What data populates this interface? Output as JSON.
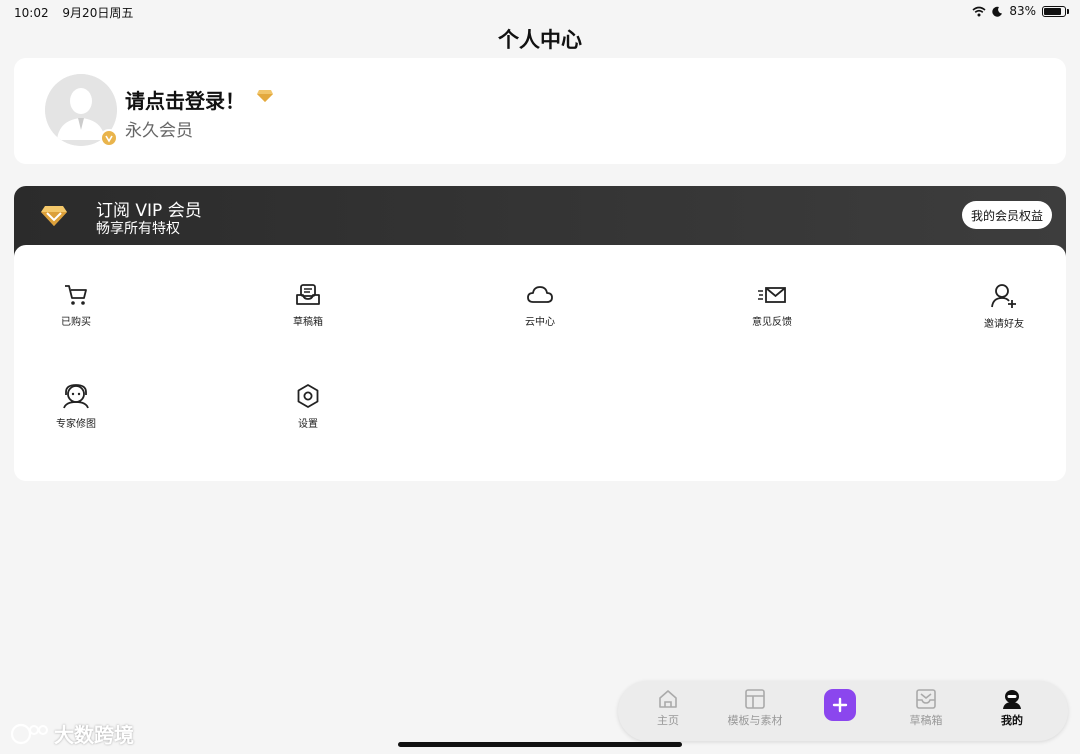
{
  "status_bar": {
    "time": "10:02",
    "date": "9月20日周五",
    "battery": "83%",
    "battery_level": 0.83
  },
  "page_title": "个人中心",
  "profile": {
    "login_prompt": "请点击登录！",
    "member_status": "永久会员"
  },
  "vip_banner": {
    "title": "订阅 VIP 会员",
    "subtitle": "畅享所有特权",
    "button_label": "我的会员权益"
  },
  "menu": {
    "items": [
      {
        "label": "已购买",
        "icon": "cart-icon"
      },
      {
        "label": "草稿箱",
        "icon": "draft-box-icon"
      },
      {
        "label": "云中心",
        "icon": "cloud-icon"
      },
      {
        "label": "意见反馈",
        "icon": "mail-icon"
      },
      {
        "label": "邀请好友",
        "icon": "add-user-icon"
      },
      {
        "label": "专家修图",
        "icon": "customer-service-icon"
      },
      {
        "label": "设置",
        "icon": "settings-hexagon-icon"
      }
    ]
  },
  "bottom_nav": {
    "items": [
      {
        "label": "主页",
        "icon": "home-icon"
      },
      {
        "label": "模板与素材",
        "icon": "template-icon"
      },
      {
        "label": "草稿箱",
        "icon": "inbox-icon"
      },
      {
        "label": "我的",
        "icon": "profile-icon"
      }
    ],
    "add_icon": "plus-icon",
    "active": "我的"
  },
  "watermark": {
    "text": "大数跨境"
  },
  "colors": {
    "accent": "#8b46ee",
    "gold": "#e9b44c",
    "vip_dark": "#2b2b2b"
  }
}
